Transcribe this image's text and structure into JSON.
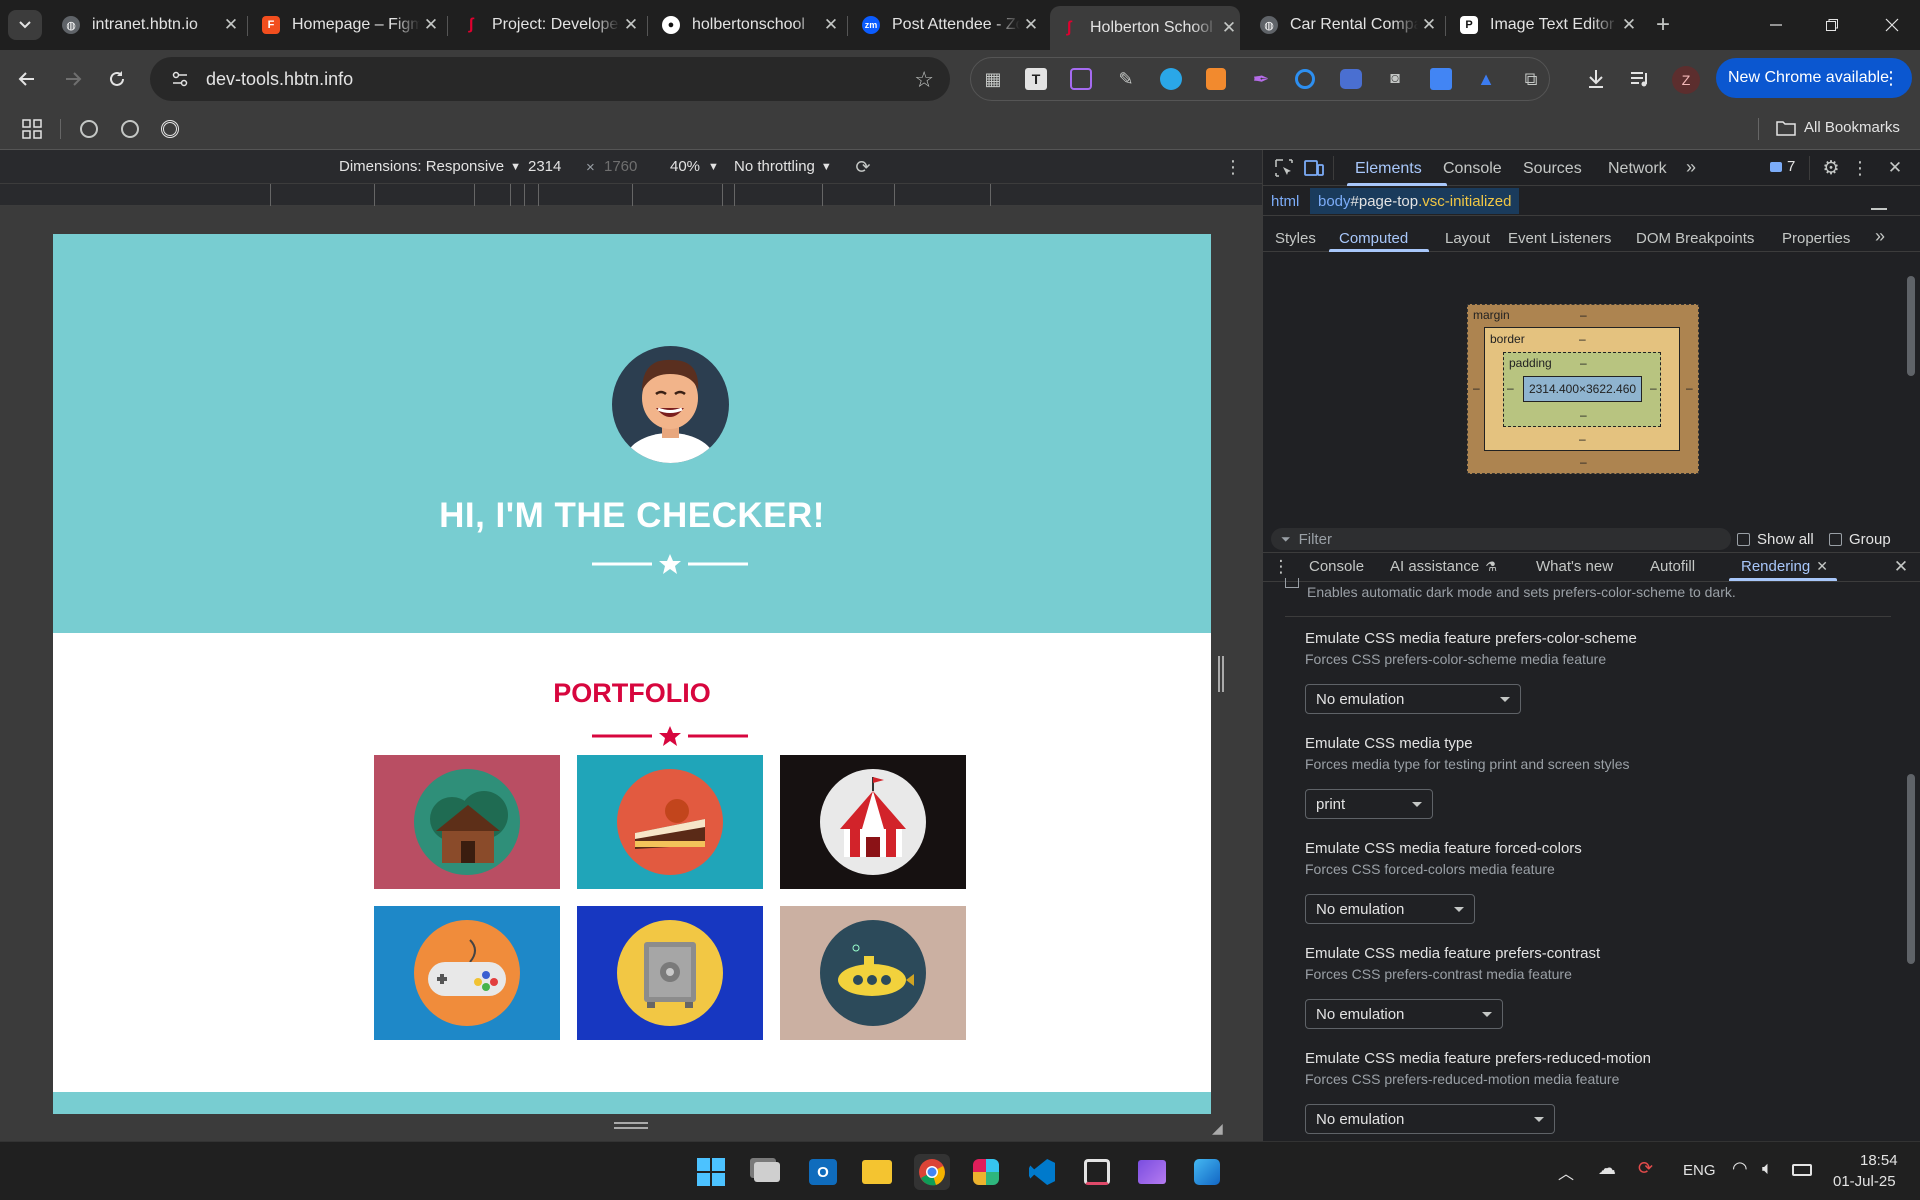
{
  "browser": {
    "tabs": [
      {
        "title": "intranet.hbtn.io",
        "favicon": "globe-icon",
        "color": "#5f6368"
      },
      {
        "title": "Homepage – Figma",
        "favicon": "figma-icon",
        "color": "#f24e1e"
      },
      {
        "title": "Project: Developer",
        "favicon": "holberton-icon",
        "color": "#e0002f"
      },
      {
        "title": "holbertonschool",
        "favicon": "github-icon",
        "color": "#ffffff"
      },
      {
        "title": "Post Attendee - Zoom",
        "favicon": "zoom-icon",
        "color": "#0b5cff"
      },
      {
        "title": "Holberton School",
        "favicon": "holberton-icon",
        "color": "#e0002f"
      },
      {
        "title": "Car Rental Company",
        "favicon": "globe-icon",
        "color": "#5f6368"
      },
      {
        "title": "Image Text Editor",
        "favicon": "editor-icon",
        "color": "#ffffff"
      }
    ],
    "active_tab": 5,
    "url": "dev-tools.hbtn.info",
    "new_chrome": "New Chrome available",
    "profile": "Z",
    "all_bookmarks": "All Bookmarks"
  },
  "device_toolbar": {
    "dimensions": "Dimensions: Responsive",
    "width": "2314",
    "times": "×",
    "height": "1760",
    "zoom": "40%",
    "throttling": "No throttling"
  },
  "site": {
    "hero_title": "HI, I'M THE CHECKER!",
    "portfolio_title": "PORTFOLIO",
    "colors": {
      "hero": "#78cdd1",
      "accent": "#d7063e",
      "white": "#ffffff"
    },
    "tiles": [
      {
        "name": "cabin",
        "bg": "#b94e63",
        "circle": "#2f8f79"
      },
      {
        "name": "cake",
        "bg": "#20a5b9",
        "circle": "#e25a40"
      },
      {
        "name": "circus",
        "bg": "#161111",
        "circle": "#e9e9e9"
      },
      {
        "name": "game-controller",
        "bg": "#1e88c8",
        "circle": "#f08c3b"
      },
      {
        "name": "safe",
        "bg": "#1737c1",
        "circle": "#f2c744"
      },
      {
        "name": "submarine",
        "bg": "#cbb0a2",
        "circle": "#2c4a5a"
      }
    ]
  },
  "devtools": {
    "tabs": [
      "Elements",
      "Console",
      "Sources",
      "Network"
    ],
    "issues_count": "7",
    "breadcrumb": {
      "html": "html",
      "body": "body",
      "body_id": "#page-top",
      "body_class": ".vsc-initialized"
    },
    "subtabs": [
      "Styles",
      "Computed",
      "Layout",
      "Event Listeners",
      "DOM Breakpoints",
      "Properties"
    ],
    "boxmodel": {
      "margin": "margin",
      "border": "border",
      "padding": "padding",
      "dash": "–",
      "content": "2314.400×3622.460"
    },
    "filter_placeholder": "Filter",
    "show_all": "Show all",
    "group": "Group",
    "drawer_tabs": [
      "Console",
      "AI assistance",
      "What's new",
      "Autofill",
      "Rendering"
    ],
    "rendering": {
      "top_desc": "Enables automatic dark mode and sets prefers-color-scheme to dark.",
      "sections": [
        {
          "title": "Emulate CSS media feature prefers-color-scheme",
          "desc": "Forces CSS prefers-color-scheme media feature",
          "value": "No emulation"
        },
        {
          "title": "Emulate CSS media type",
          "desc": "Forces media type for testing print and screen styles",
          "value": "print"
        },
        {
          "title": "Emulate CSS media feature forced-colors",
          "desc": "Forces CSS forced-colors media feature",
          "value": "No emulation"
        },
        {
          "title": "Emulate CSS media feature prefers-contrast",
          "desc": "Forces CSS prefers-contrast media feature",
          "value": "No emulation"
        },
        {
          "title": "Emulate CSS media feature prefers-reduced-motion",
          "desc": "Forces CSS prefers-reduced-motion media feature",
          "value": "No emulation"
        }
      ]
    }
  },
  "taskbar": {
    "lang": "ENG",
    "time": "18:54",
    "date": "01-Jul-25"
  }
}
